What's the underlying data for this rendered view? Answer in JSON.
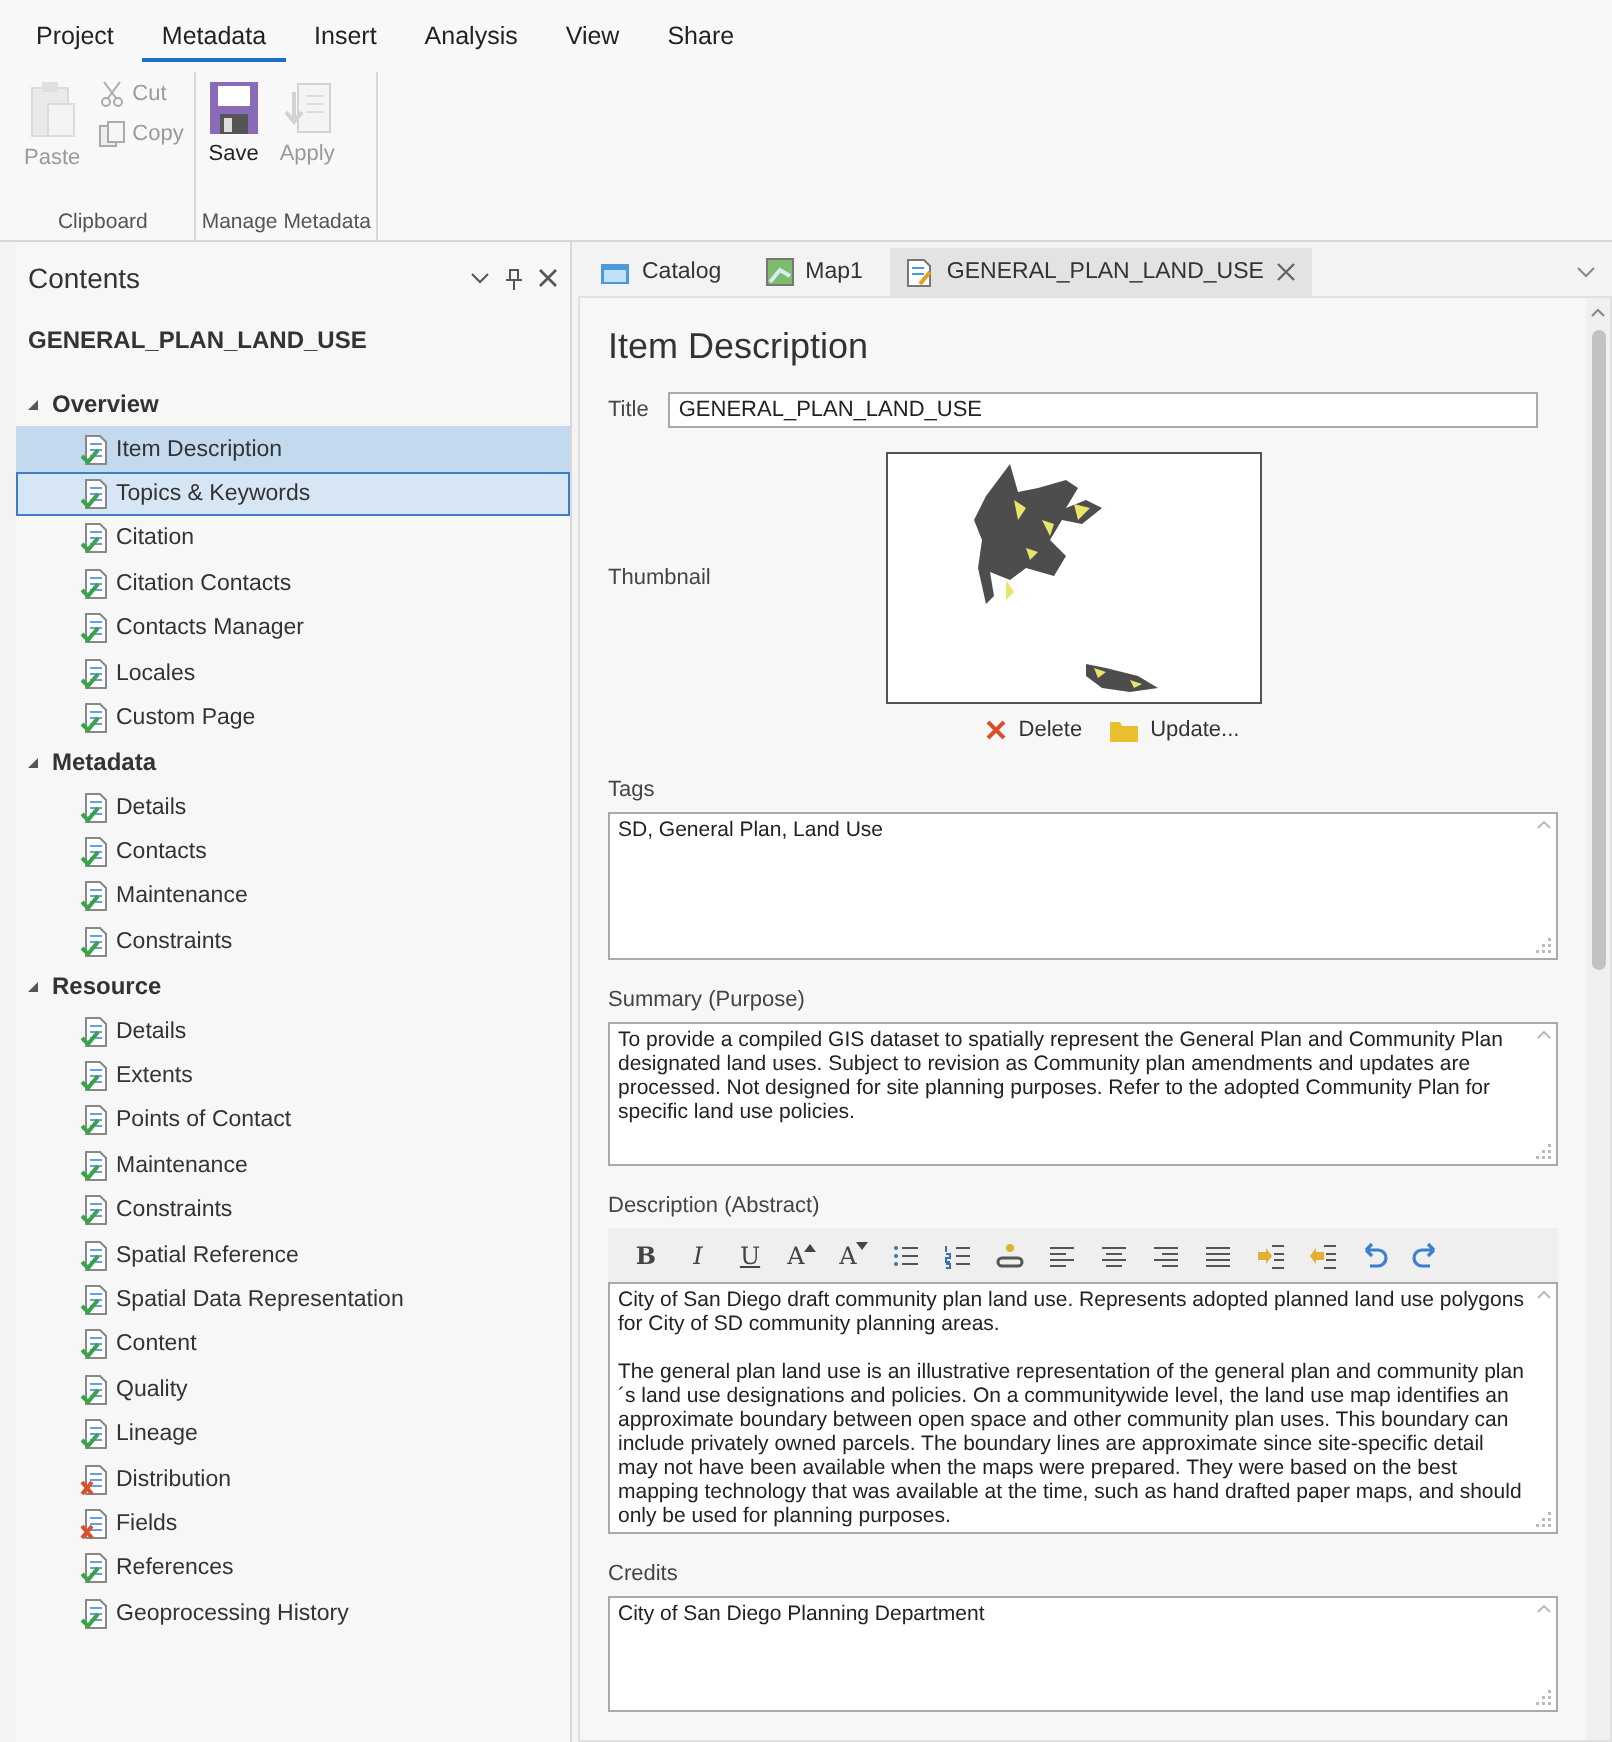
{
  "ribbon": {
    "tabs": [
      {
        "label": "Project",
        "selected": false
      },
      {
        "label": "Metadata",
        "selected": true
      },
      {
        "label": "Insert",
        "selected": false
      },
      {
        "label": "Analysis",
        "selected": false
      },
      {
        "label": "View",
        "selected": false
      },
      {
        "label": "Share",
        "selected": false
      }
    ],
    "groups": [
      {
        "label": "Clipboard",
        "commands": [
          {
            "kind": "large",
            "label": "Paste",
            "disabled": true
          },
          {
            "kind": "small",
            "label": "Cut",
            "disabled": true
          },
          {
            "kind": "small",
            "label": "Copy",
            "disabled": true
          }
        ]
      },
      {
        "label": "Manage Metadata",
        "commands": [
          {
            "kind": "large",
            "label": "Save",
            "disabled": false
          },
          {
            "kind": "large",
            "label": "Apply",
            "disabled": true
          }
        ]
      }
    ]
  },
  "contents": {
    "title": "Contents",
    "item_name": "GENERAL_PLAN_LAND_USE",
    "sections": [
      {
        "label": "Overview",
        "expanded": true,
        "children": [
          {
            "label": "Item Description",
            "valid": true,
            "selected": true,
            "focused": false
          },
          {
            "label": "Topics & Keywords",
            "valid": true,
            "selected": false,
            "focused": true
          },
          {
            "label": "Citation",
            "valid": true,
            "selected": false,
            "focused": false
          },
          {
            "label": "Citation Contacts",
            "valid": true,
            "selected": false,
            "focused": false
          },
          {
            "label": "Contacts Manager",
            "valid": true,
            "selected": false,
            "focused": false
          },
          {
            "label": "Locales",
            "valid": true,
            "selected": false,
            "focused": false
          },
          {
            "label": "Custom Page",
            "valid": true,
            "selected": false,
            "focused": false
          }
        ]
      },
      {
        "label": "Metadata",
        "expanded": true,
        "children": [
          {
            "label": "Details",
            "valid": true,
            "selected": false,
            "focused": false
          },
          {
            "label": "Contacts",
            "valid": true,
            "selected": false,
            "focused": false
          },
          {
            "label": "Maintenance",
            "valid": true,
            "selected": false,
            "focused": false
          },
          {
            "label": "Constraints",
            "valid": true,
            "selected": false,
            "focused": false
          }
        ]
      },
      {
        "label": "Resource",
        "expanded": true,
        "children": [
          {
            "label": "Details",
            "valid": true,
            "selected": false,
            "focused": false
          },
          {
            "label": "Extents",
            "valid": true,
            "selected": false,
            "focused": false
          },
          {
            "label": "Points of Contact",
            "valid": true,
            "selected": false,
            "focused": false
          },
          {
            "label": "Maintenance",
            "valid": true,
            "selected": false,
            "focused": false
          },
          {
            "label": "Constraints",
            "valid": true,
            "selected": false,
            "focused": false
          },
          {
            "label": "Spatial Reference",
            "valid": true,
            "selected": false,
            "focused": false
          },
          {
            "label": "Spatial Data Representation",
            "valid": true,
            "selected": false,
            "focused": false
          },
          {
            "label": "Content",
            "valid": true,
            "selected": false,
            "focused": false
          },
          {
            "label": "Quality",
            "valid": true,
            "selected": false,
            "focused": false
          },
          {
            "label": "Lineage",
            "valid": true,
            "selected": false,
            "focused": false
          },
          {
            "label": "Distribution",
            "valid": false,
            "selected": false,
            "focused": false
          },
          {
            "label": "Fields",
            "valid": false,
            "selected": false,
            "focused": false
          },
          {
            "label": "References",
            "valid": true,
            "selected": false,
            "focused": false
          },
          {
            "label": "Geoprocessing History",
            "valid": true,
            "selected": false,
            "focused": false
          }
        ]
      }
    ]
  },
  "editor_tabs": [
    {
      "label": "Catalog",
      "selected": false,
      "closable": false
    },
    {
      "label": "Map1",
      "selected": false,
      "closable": false
    },
    {
      "label": "GENERAL_PLAN_LAND_USE",
      "selected": true,
      "closable": true
    }
  ],
  "form": {
    "heading": "Item Description",
    "title": {
      "label": "Title",
      "value": "GENERAL_PLAN_LAND_USE"
    },
    "thumbnail": {
      "label": "Thumbnail",
      "actions": [
        {
          "label": "Delete"
        },
        {
          "label": "Update..."
        }
      ]
    },
    "tags": {
      "label": "Tags",
      "value": "SD, General Plan, Land Use"
    },
    "summary": {
      "label": "Summary (Purpose)",
      "value": "To provide a compiled GIS dataset to spatially represent the General Plan and Community Plan designated land uses.  Subject to revision as Community plan amendments and updates are processed.  Not designed for site planning purposes.  Refer to the adopted Community Plan for specific land use policies."
    },
    "description": {
      "label": "Description (Abstract)",
      "toolbar": [
        {
          "kind": "bold",
          "label": "B"
        },
        {
          "kind": "italic",
          "label": "I"
        },
        {
          "kind": "underline",
          "label": "U"
        },
        {
          "kind": "grow",
          "label": "A"
        },
        {
          "kind": "shrink",
          "label": "A"
        }
      ],
      "paragraphs": [
        "City of San Diego draft community plan land use. Represents adopted planned land use polygons for City of SD community planning areas.",
        "The general plan land use is an illustrative representation of the general plan and community plan´s land use designations and policies.  On a communitywide level, the land use map identifies an approximate boundary between open space and other community plan uses.  This boundary can include privately owned parcels.  The boundary lines are approximate since site-specific detail may not have been available when the maps were prepared. They were based on the best mapping technology that was available at the time, such as hand drafted paper maps, and should only be used for planning purposes."
      ]
    },
    "credits": {
      "label": "Credits",
      "value": "City of San Diego Planning Department"
    }
  }
}
